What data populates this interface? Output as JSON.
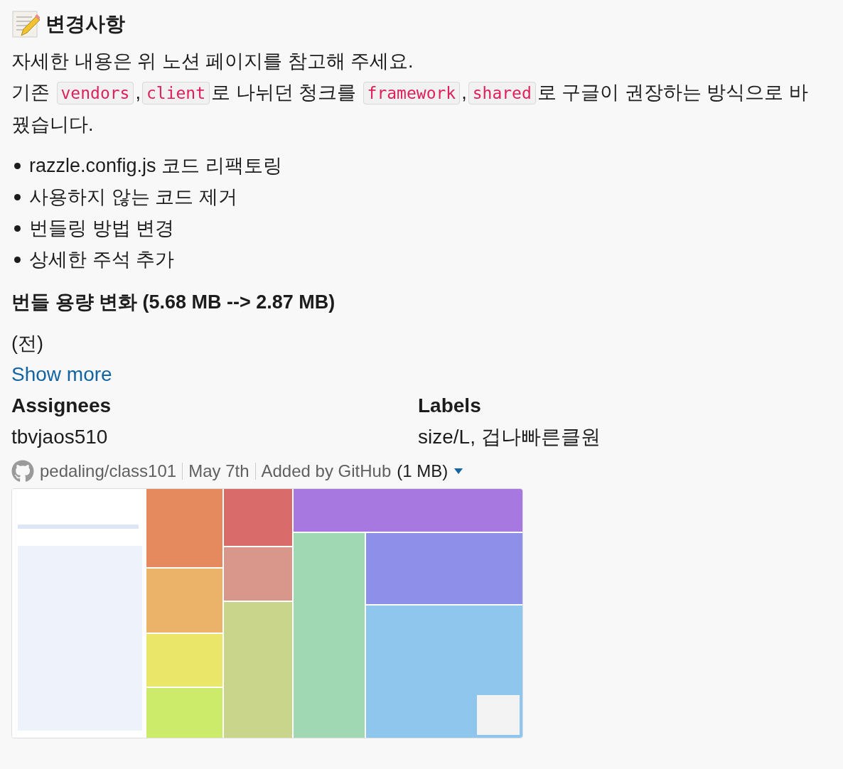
{
  "title": "변경사항",
  "paragraphs": [
    [
      {
        "kind": "text",
        "text": "자세한 내용은 위 노션 페이지를 참고해 주세요."
      }
    ],
    [
      {
        "kind": "text",
        "text": "기존 "
      },
      {
        "kind": "code",
        "text": "vendors"
      },
      {
        "kind": "text",
        "text": ","
      },
      {
        "kind": "code",
        "text": "client"
      },
      {
        "kind": "text",
        "text": "로 나뉘던 청크를 "
      },
      {
        "kind": "code",
        "text": "framework"
      },
      {
        "kind": "text",
        "text": ","
      },
      {
        "kind": "code",
        "text": "shared"
      },
      {
        "kind": "text",
        "text": "로 구글이 권장하는 방식으로 바"
      },
      {
        "kind": "text",
        "text": "꿨습니다."
      }
    ]
  ],
  "bullets": [
    "razzle.config.js 코드 리팩토링",
    "사용하지 않는 코드 제거",
    "번들링 방법 변경",
    "상세한 주석 추가"
  ],
  "subheading": "번들 용량 변화 (5.68 MB --> 2.87 MB)",
  "note": "(전)",
  "show_more": "Show more",
  "fields": [
    {
      "label": "Assignees",
      "value": "tbvjaos510"
    },
    {
      "label": "Labels",
      "value": "size/L, 겁나빠른클원"
    }
  ],
  "footer": {
    "repo": "pedaling/class101",
    "date": "May 7th",
    "added_by": "Added by GitHub",
    "size": "(1 MB)"
  },
  "attachment": {
    "kind": "picture"
  }
}
